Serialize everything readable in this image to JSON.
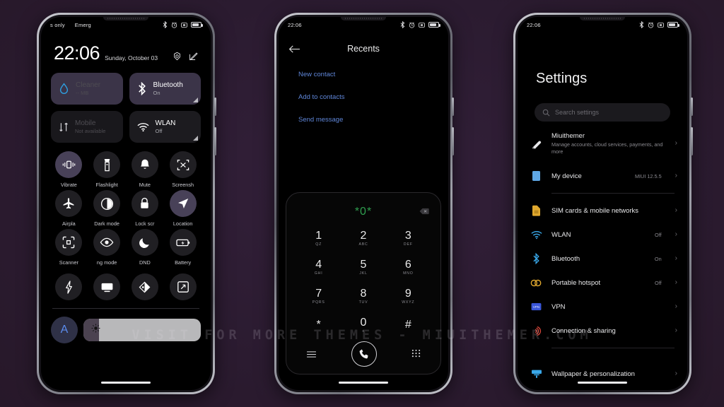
{
  "watermark": "VISIT FOR MORE THEMES - MIUITHEMER.COM",
  "colors": {
    "background": "#2b1b30",
    "accent_blue": "#5f86d8",
    "dial_green": "#2f9e4f",
    "tile_active": "#3b3448",
    "screen_black": "#000000"
  },
  "phone1": {
    "statusbar": {
      "left1": "s only",
      "left2": "Emerg",
      "icons": [
        "bluetooth-icon",
        "alarm-icon",
        "screenshot-icon",
        "battery-icon"
      ]
    },
    "clock": {
      "time": "22:06",
      "date": "Sunday, October 03",
      "icons": [
        "settings-gear-icon",
        "edit-icon"
      ]
    },
    "big_tiles": [
      {
        "name": "Cleaner",
        "status": "-- MB",
        "state": "on",
        "icon": "water-drop-icon",
        "faded": true,
        "corner": false
      },
      {
        "name": "Bluetooth",
        "status": "On",
        "state": "on",
        "icon": "bluetooth-icon",
        "faded": false,
        "corner": true
      },
      {
        "name": "Mobile",
        "status": "Not available",
        "state": "off",
        "icon": "mobile-data-icon",
        "faded": true,
        "corner": false
      },
      {
        "name": "WLAN",
        "status": "Off",
        "state": "off",
        "icon": "wifi-icon",
        "faded": false,
        "corner": true
      }
    ],
    "tiles": [
      {
        "label": "Vibrate",
        "icon": "vibrate-icon",
        "active": true
      },
      {
        "label": "Flashlight",
        "icon": "flashlight-icon",
        "active": false
      },
      {
        "label": "Mute",
        "icon": "bell-icon",
        "active": false
      },
      {
        "label": "Screensh",
        "icon": "screenshot-icon",
        "active": false
      },
      {
        "label": "Airpla",
        "icon": "airplane-icon",
        "active": false
      },
      {
        "label": "Dark mode",
        "icon": "dark-mode-icon",
        "active": false
      },
      {
        "label": "Lock scr",
        "icon": "lock-icon",
        "active": false
      },
      {
        "label": "Location",
        "icon": "location-icon",
        "active": true
      },
      {
        "label": "Scanner",
        "icon": "scanner-icon",
        "active": false
      },
      {
        "label": "ng mode",
        "icon": "eye-icon",
        "active": false
      },
      {
        "label": "DND",
        "icon": "moon-icon",
        "active": false
      },
      {
        "label": "Battery",
        "icon": "battery-saver-icon",
        "active": false
      }
    ],
    "tiles_row4": [
      {
        "label": "",
        "icon": "lightning-icon",
        "active": false
      },
      {
        "label": "",
        "icon": "cast-icon",
        "active": false
      },
      {
        "label": "",
        "icon": "reading-mode-icon",
        "active": false
      },
      {
        "label": "",
        "icon": "expand-icon",
        "active": false
      }
    ],
    "brightness": {
      "auto_label": "A",
      "icon": "sun-icon",
      "fill_percent": 12
    }
  },
  "phone2": {
    "statusbar": {
      "time": "22:06",
      "icons": [
        "bluetooth-icon",
        "alarm-icon",
        "screenshot-icon",
        "battery-icon"
      ]
    },
    "header": {
      "back_icon": "arrow-left-icon",
      "title": "Recents"
    },
    "actions": [
      "New contact",
      "Add to contacts",
      "Send message"
    ],
    "dialer": {
      "input_value": "*0*",
      "backspace_icon": "backspace-icon",
      "keys": [
        {
          "digit": "1",
          "letters": "QZ"
        },
        {
          "digit": "2",
          "letters": "ABC"
        },
        {
          "digit": "3",
          "letters": "DEF"
        },
        {
          "digit": "4",
          "letters": "GHI"
        },
        {
          "digit": "5",
          "letters": "JKL"
        },
        {
          "digit": "6",
          "letters": "MNO"
        },
        {
          "digit": "7",
          "letters": "PQRS"
        },
        {
          "digit": "8",
          "letters": "TUV"
        },
        {
          "digit": "9",
          "letters": "WXYZ"
        },
        {
          "digit": "*",
          "letters": ""
        },
        {
          "digit": "0",
          "letters": "+"
        },
        {
          "digit": "#",
          "letters": ""
        }
      ],
      "bottom": {
        "menu_icon": "menu-icon",
        "call_icon": "phone-call-icon",
        "keypad_icon": "keypad-icon"
      }
    }
  },
  "phone3": {
    "statusbar": {
      "time": "22:06",
      "icons": [
        "bluetooth-icon",
        "alarm-icon",
        "screenshot-icon",
        "battery-icon"
      ]
    },
    "title": "Settings",
    "search": {
      "placeholder": "Search settings",
      "icon": "search-icon"
    },
    "account": {
      "name": "Miuithemer",
      "desc": "Manage accounts, cloud services, payments, and more",
      "icon": "account-icon"
    },
    "device": {
      "name": "My device",
      "value": "MIUI 12.5.5",
      "icon": "device-icon"
    },
    "items": [
      {
        "name": "SIM cards & mobile networks",
        "value": "",
        "icon": "sim-card-icon"
      },
      {
        "name": "WLAN",
        "value": "Off",
        "icon": "wifi-icon"
      },
      {
        "name": "Bluetooth",
        "value": "On",
        "icon": "bluetooth-icon"
      },
      {
        "name": "Portable hotspot",
        "value": "Off",
        "icon": "hotspot-icon"
      },
      {
        "name": "VPN",
        "value": "",
        "icon": "vpn-icon"
      },
      {
        "name": "Connection & sharing",
        "value": "",
        "icon": "connection-sharing-icon"
      }
    ],
    "items2": [
      {
        "name": "Wallpaper & personalization",
        "value": "",
        "icon": "wallpaper-icon"
      }
    ]
  }
}
